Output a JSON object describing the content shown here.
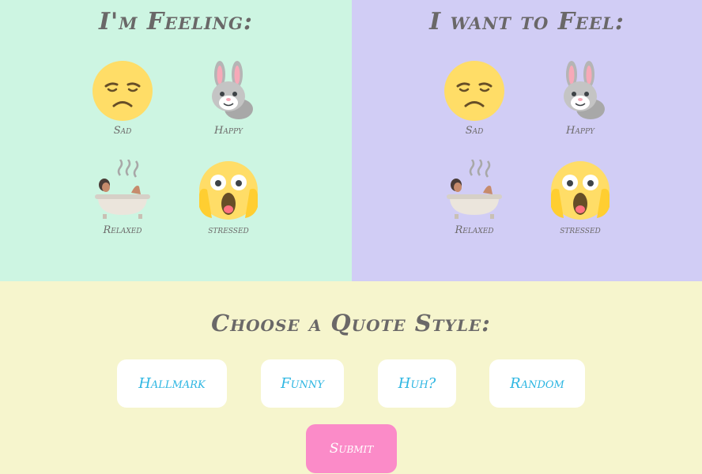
{
  "feeling": {
    "title": "I'm Feeling:",
    "moods": [
      {
        "label": "Sad",
        "icon": "sad-face-icon"
      },
      {
        "label": "Happy",
        "icon": "bunny-icon"
      },
      {
        "label": "Relaxed",
        "icon": "bath-icon"
      },
      {
        "label": "stressed",
        "icon": "screaming-face-icon"
      }
    ]
  },
  "want": {
    "title": "I want to Feel:",
    "moods": [
      {
        "label": "Sad",
        "icon": "sad-face-icon"
      },
      {
        "label": "Happy",
        "icon": "bunny-icon"
      },
      {
        "label": "Relaxed",
        "icon": "bath-icon"
      },
      {
        "label": "stressed",
        "icon": "screaming-face-icon"
      }
    ]
  },
  "quote_style": {
    "title": "Choose a Quote Style:",
    "options": [
      "Hallmark",
      "Funny",
      "Huh?",
      "Random"
    ],
    "submit_label": "Submit"
  },
  "colors": {
    "left_panel": "#cdf5e2",
    "right_panel": "#d1cdf5",
    "bottom_panel": "#f6f5cd",
    "button_text": "#2db6e2",
    "submit": "#fb8bc8"
  }
}
